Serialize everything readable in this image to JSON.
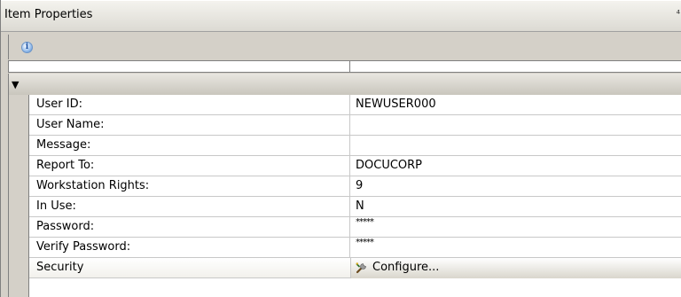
{
  "panel": {
    "title": "Item Properties",
    "pin_glyph": "⁴"
  },
  "toolbar": {
    "info_icon": "i"
  },
  "category": {
    "toggle_glyph": "▼"
  },
  "properties": [
    {
      "label": "User ID:",
      "value": "NEWUSER000"
    },
    {
      "label": "User Name:",
      "value": ""
    },
    {
      "label": "Message:",
      "value": ""
    },
    {
      "label": "Report To:",
      "value": "DOCUCORP"
    },
    {
      "label": "Workstation Rights:",
      "value": "9"
    },
    {
      "label": "In Use:",
      "value": "N"
    },
    {
      "label": "Password:",
      "value": "*****"
    },
    {
      "label": "Verify Password:",
      "value": "*****"
    },
    {
      "label": "Security",
      "value": "Configure..."
    }
  ],
  "colors": {
    "panel_bg": "#d4d0c8",
    "grid_bg": "#ffffff",
    "grid_line": "#c8c8c8",
    "icon_blue": "#4e85c9"
  }
}
